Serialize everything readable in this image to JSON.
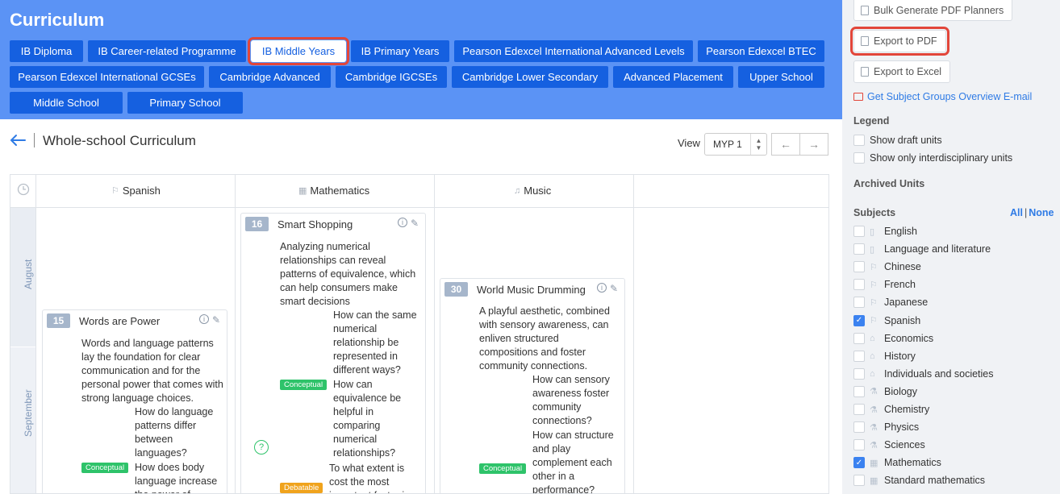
{
  "header": {
    "title": "Curriculum",
    "programmes": [
      "IB Diploma",
      "IB Career-related Programme",
      "IB Middle Years",
      "IB Primary Years",
      "Pearson Edexcel International Advanced Levels",
      "Pearson Edexcel BTEC",
      "Pearson Edexcel International GCSEs",
      "Cambridge Advanced",
      "Cambridge IGCSEs",
      "Cambridge Lower Secondary",
      "Advanced Placement",
      "Upper School",
      "Middle School",
      "Primary School"
    ],
    "active_programme": "IB Middle Years"
  },
  "page": {
    "title": "Whole-school Curriculum",
    "view_label": "View",
    "view_value": "MYP 1"
  },
  "grid": {
    "columns": [
      "Spanish",
      "Mathematics",
      "Music"
    ],
    "months": [
      "August",
      "September"
    ]
  },
  "units": [
    {
      "number": "15",
      "title": "Words are Power",
      "statement": "Words and language patterns lay the foundation for clear communication and for the personal power that comes with strong language choices.",
      "questions": [
        {
          "text": "How do language patterns differ between languages?",
          "tag": ""
        },
        {
          "text": "How does body language increase the power of",
          "tag": "Conceptual"
        }
      ]
    },
    {
      "number": "16",
      "title": "Smart Shopping",
      "statement": "Analyzing numerical relationships can reveal patterns of equivalence, which can help consumers make smart decisions",
      "questions": [
        {
          "text": "How can the same numerical relationship be represented in different ways?",
          "tag": ""
        },
        {
          "text": "How can equivalence be helpful in comparing numerical relationships?",
          "tag": "Conceptual"
        },
        {
          "text": "To what extent is cost the most important factor in",
          "tag": "Debatable"
        }
      ]
    },
    {
      "number": "30",
      "title": "World Music Drumming",
      "statement": "A playful aesthetic, combined with sensory awareness, can enliven structured compositions and foster community connections.",
      "questions": [
        {
          "text": "How can sensory awareness foster community connections?",
          "tag": ""
        },
        {
          "text": "How can structure and play complement each other in a performance?",
          "tag": "Conceptual"
        }
      ]
    }
  ],
  "sidebar": {
    "bulk_generate": "Bulk Generate PDF Planners",
    "export_pdf": "Export to PDF",
    "export_excel": "Export to Excel",
    "email_link": "Get Subject Groups Overview E-mail",
    "legend_heading": "Legend",
    "legend_items": [
      {
        "label": "Show draft units",
        "checked": false
      },
      {
        "label": "Show only interdisciplinary units",
        "checked": false
      }
    ],
    "archived_heading": "Archived Units",
    "subjects_heading": "Subjects",
    "all_label": "All",
    "none_label": "None",
    "subjects": [
      {
        "label": "English",
        "checked": false,
        "icon": "book-icon"
      },
      {
        "label": "Language and literature",
        "checked": false,
        "icon": "book-icon"
      },
      {
        "label": "Chinese",
        "checked": false,
        "icon": "flag-icon"
      },
      {
        "label": "French",
        "checked": false,
        "icon": "flag-icon"
      },
      {
        "label": "Japanese",
        "checked": false,
        "icon": "flag-icon"
      },
      {
        "label": "Spanish",
        "checked": true,
        "icon": "flag-icon"
      },
      {
        "label": "Economics",
        "checked": false,
        "icon": "building-icon"
      },
      {
        "label": "History",
        "checked": false,
        "icon": "building-icon"
      },
      {
        "label": "Individuals and societies",
        "checked": false,
        "icon": "building-icon"
      },
      {
        "label": "Biology",
        "checked": false,
        "icon": "flask-icon"
      },
      {
        "label": "Chemistry",
        "checked": false,
        "icon": "flask-icon"
      },
      {
        "label": "Physics",
        "checked": false,
        "icon": "flask-icon"
      },
      {
        "label": "Sciences",
        "checked": false,
        "icon": "flask-icon"
      },
      {
        "label": "Mathematics",
        "checked": true,
        "icon": "calculator-icon"
      },
      {
        "label": "Standard mathematics",
        "checked": false,
        "icon": "calculator-icon"
      }
    ]
  },
  "colors": {
    "header_bg": "#5b93f5",
    "button_bg": "#1560e0",
    "highlight": "#e2463a",
    "link": "#2f7be5",
    "conceptual_tag": "#2ec36a",
    "debatable_tag": "#f0a31c"
  }
}
